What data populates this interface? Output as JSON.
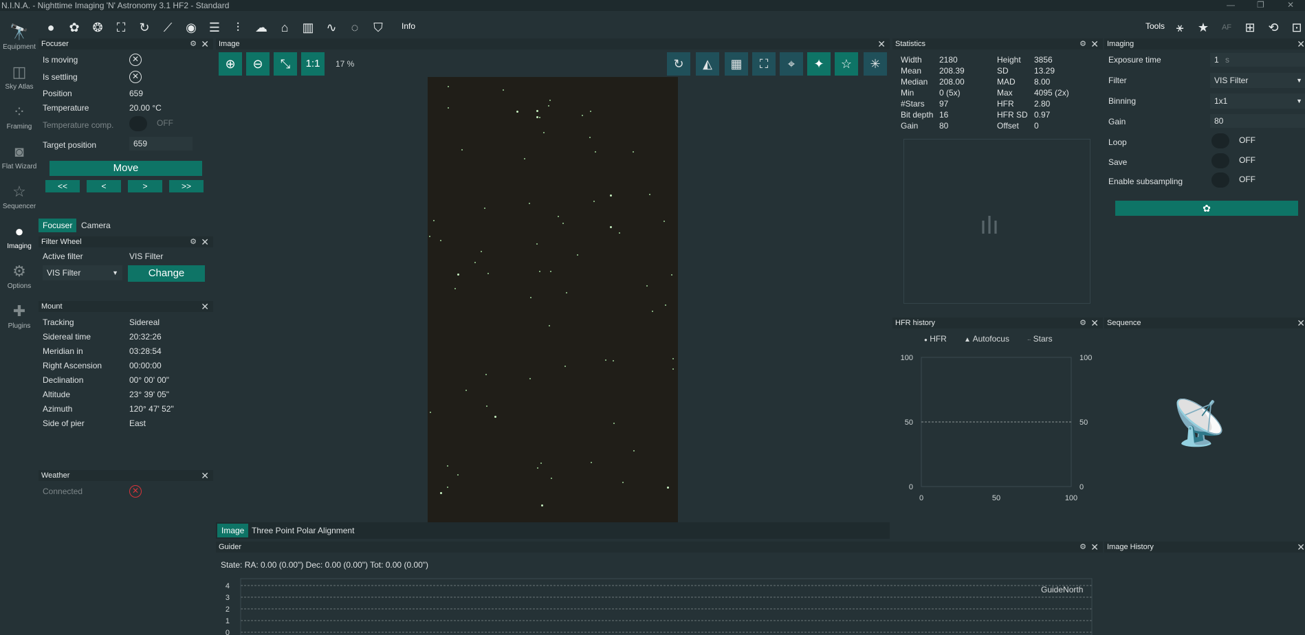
{
  "window": {
    "title": "N.I.N.A. - Nighttime Imaging 'N' Astronomy 3.1 HF2  -  Standard",
    "min": "—",
    "max": "❐",
    "close": "✕"
  },
  "topbar": {
    "info_label": "Info",
    "tools_label": "Tools"
  },
  "nav": {
    "items": [
      {
        "label": "Equipment"
      },
      {
        "label": "Sky Atlas"
      },
      {
        "label": "Framing"
      },
      {
        "label": "Flat Wizard"
      },
      {
        "label": "Sequencer"
      },
      {
        "label": "Imaging"
      },
      {
        "label": "Options"
      },
      {
        "label": "Plugins"
      }
    ]
  },
  "focuser": {
    "title": "Focuser",
    "rows": [
      {
        "label": "Is moving",
        "value": ""
      },
      {
        "label": "Is settling",
        "value": ""
      },
      {
        "label": "Position",
        "value": "659"
      },
      {
        "label": "Temperature",
        "value": "20.00 °C"
      },
      {
        "label": "Temperature comp.",
        "value": "OFF"
      },
      {
        "label": "Target position",
        "value": "659"
      }
    ],
    "move_label": "Move",
    "step_buttons": [
      "<<",
      "<",
      ">",
      ">>"
    ],
    "tabs": [
      "Focuser",
      "Camera"
    ]
  },
  "filterwheel": {
    "title": "Filter Wheel",
    "active_label": "Active filter",
    "active_value": "VIS Filter",
    "select_value": "VIS Filter",
    "change_label": "Change"
  },
  "mount": {
    "title": "Mount",
    "rows": [
      {
        "label": "Tracking",
        "value": "Sidereal"
      },
      {
        "label": "Sidereal time",
        "value": "20:32:26"
      },
      {
        "label": "Meridian in",
        "value": "03:28:54"
      },
      {
        "label": "Right Ascension",
        "value": "00:00:00"
      },
      {
        "label": "Declination",
        "value": "00° 00' 00\""
      },
      {
        "label": "Altitude",
        "value": "23° 39' 05\""
      },
      {
        "label": "Azimuth",
        "value": "120° 47' 52\""
      },
      {
        "label": "Side of pier",
        "value": "East"
      }
    ]
  },
  "weather": {
    "title": "Weather",
    "connected_label": "Connected"
  },
  "image": {
    "title": "Image",
    "zoom_label": "1:1",
    "zoom_percent": "17 %",
    "tabs": [
      "Image",
      "Three Point Polar Alignment"
    ]
  },
  "statistics": {
    "title": "Statistics",
    "left": [
      {
        "label": "Width",
        "value": "2180"
      },
      {
        "label": "Mean",
        "value": "208.39"
      },
      {
        "label": "Median",
        "value": "208.00"
      },
      {
        "label": "Min",
        "value": "0 (5x)"
      },
      {
        "label": "#Stars",
        "value": "97"
      },
      {
        "label": "Bit depth",
        "value": "16"
      },
      {
        "label": "Gain",
        "value": "80"
      }
    ],
    "right": [
      {
        "label": "Height",
        "value": "3856"
      },
      {
        "label": "SD",
        "value": "13.29"
      },
      {
        "label": "MAD",
        "value": "8.00"
      },
      {
        "label": "Max",
        "value": "4095 (2x)"
      },
      {
        "label": "HFR",
        "value": "2.80"
      },
      {
        "label": "HFR SD",
        "value": "0.97"
      },
      {
        "label": "Offset",
        "value": "0"
      }
    ]
  },
  "imaging": {
    "title": "Imaging",
    "exposure_label": "Exposure time",
    "exposure_value": "1",
    "exposure_unit": "s",
    "filter_label": "Filter",
    "filter_value": "VIS Filter",
    "binning_label": "Binning",
    "binning_value": "1x1",
    "gain_label": "Gain",
    "gain_value": "80",
    "loop_label": "Loop",
    "loop_value": "OFF",
    "save_label": "Save",
    "save_value": "OFF",
    "subsampling_label": "Enable subsampling",
    "subsampling_value": "OFF"
  },
  "hfr_history": {
    "title": "HFR history",
    "legend": [
      "HFR",
      "Autofocus",
      "Stars"
    ]
  },
  "chart_data": {
    "type": "line",
    "title": "",
    "legend": [
      "HFR",
      "Autofocus",
      "Stars"
    ],
    "x_ticks": [
      "0",
      "50",
      "100"
    ],
    "y_left_ticks": [
      "0",
      "50",
      "100"
    ],
    "y_right_ticks": [
      "0",
      "50",
      "100"
    ],
    "xlim": [
      0,
      100
    ],
    "ylim": [
      0,
      100
    ],
    "series": []
  },
  "sequence": {
    "title": "Sequence"
  },
  "guider": {
    "title": "Guider",
    "state_text": "State:  RA: 0.00 (0.00\")  Dec: 0.00 (0.00\")  Tot: 0.00 (0.00\")",
    "y_ticks": [
      "4",
      "3",
      "2",
      "1",
      "0"
    ],
    "direction_label": "GuideNorth"
  },
  "image_history": {
    "title": "Image History"
  },
  "colors": {
    "teal": "#0e7466",
    "bg": "#253236",
    "error_red": "#d9343a"
  }
}
